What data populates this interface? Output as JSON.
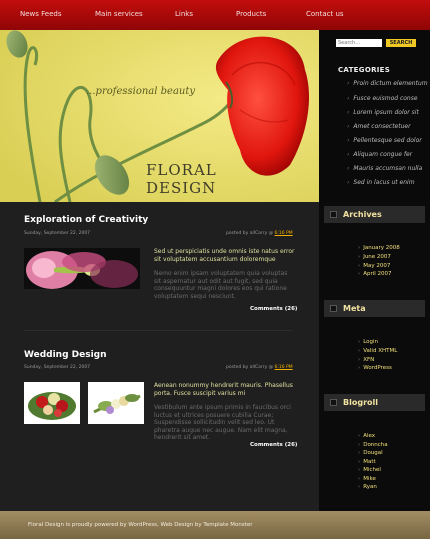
{
  "nav": {
    "items": [
      "News Feeds",
      "Main services",
      "Links",
      "Products",
      "Contact us"
    ]
  },
  "header": {
    "tagline": "...professional beauty",
    "title_line1": "FLORAL",
    "title_line2": "DESIGN"
  },
  "search": {
    "placeholder": "Search...",
    "button_label": "SEARCH"
  },
  "categories": {
    "title": "CATEGORIES",
    "items": [
      "Proin dictum elementum",
      "Fusce euismod conse",
      "Lorem ipsum dolor sit",
      "Amet consectetuer",
      "Pellentesque sed dolor",
      "Aliquam congue fer",
      "Mauris accumsan nulla",
      "Sed in lacus ut enim"
    ]
  },
  "posts": [
    {
      "title": "Exploration of Creativity",
      "date": "Sunday, September 22, 2007",
      "posted_by": "posted by allCarry @",
      "time": "6:16 PM",
      "lead": "Sed ut perspiciatis unde omnis iste natus error sit voluptatem accusantium doloremque",
      "body": "Nemo enim ipsam voluptatem quia voluptas sit aspernatur aut odit aut fugit, sed quia consequuntur magni dolores eos qui ratione voluptatem sequi nesciunt.",
      "comments": "Comments (26)"
    },
    {
      "title": "Wedding Design",
      "date": "Sunday, September 22, 2007",
      "posted_by": "posted by allCarry @",
      "time": "6:16 PM",
      "lead": "Aenean nonummy hendrerit mauris. Phasellus porta. Fusce suscipit varius mi",
      "body": "Vestibulum ante ipsum primis in faucibus orci luctus et ultrices posuere cubilia Curae; Suspendisse sollicitudin velit sed leo. Ut pharetra augue nec augue. Nam elit magna, hendrerit sit amet.",
      "comments": "Comments (26)"
    }
  ],
  "archives": {
    "title": "Archives",
    "items": [
      "January 2008",
      "June 2007",
      "May 2007",
      "April 2007"
    ]
  },
  "meta": {
    "title": "Meta",
    "items": [
      "Login",
      "Valid XHTML",
      "XFN",
      "WordPress"
    ]
  },
  "blogroll": {
    "title": "Blogroll",
    "items": [
      "Alex",
      "Donncha",
      "Dougal",
      "Matt",
      "Michel",
      "Mike",
      "Ryan"
    ]
  },
  "footer": {
    "text": "Floral Design is proudly powered by WordPress, Web Design by Template Monster"
  },
  "colors": {
    "nav_red": "#b00b0b",
    "header_yellow": "#ebe16e",
    "accent_gold": "#f0c823",
    "footer_tan": "#8e7a55"
  }
}
